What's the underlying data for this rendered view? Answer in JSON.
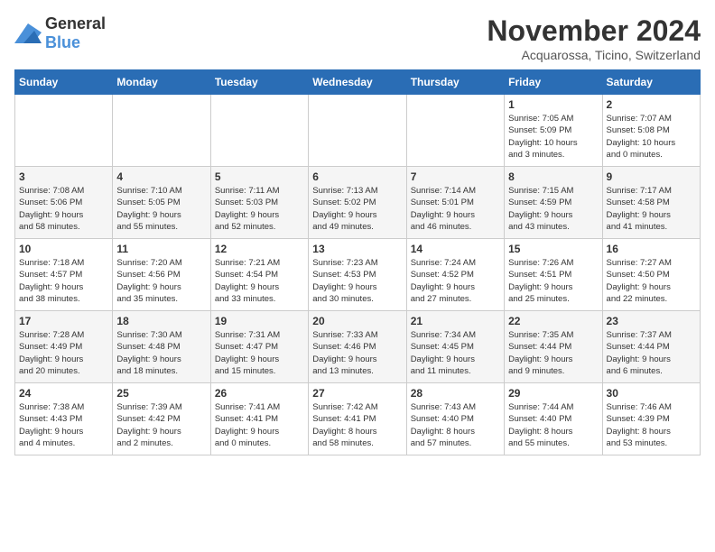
{
  "header": {
    "logo_general": "General",
    "logo_blue": "Blue",
    "title": "November 2024",
    "subtitle": "Acquarossa, Ticino, Switzerland"
  },
  "weekdays": [
    "Sunday",
    "Monday",
    "Tuesday",
    "Wednesday",
    "Thursday",
    "Friday",
    "Saturday"
  ],
  "weeks": [
    [
      {
        "day": "",
        "info": ""
      },
      {
        "day": "",
        "info": ""
      },
      {
        "day": "",
        "info": ""
      },
      {
        "day": "",
        "info": ""
      },
      {
        "day": "",
        "info": ""
      },
      {
        "day": "1",
        "info": "Sunrise: 7:05 AM\nSunset: 5:09 PM\nDaylight: 10 hours\nand 3 minutes."
      },
      {
        "day": "2",
        "info": "Sunrise: 7:07 AM\nSunset: 5:08 PM\nDaylight: 10 hours\nand 0 minutes."
      }
    ],
    [
      {
        "day": "3",
        "info": "Sunrise: 7:08 AM\nSunset: 5:06 PM\nDaylight: 9 hours\nand 58 minutes."
      },
      {
        "day": "4",
        "info": "Sunrise: 7:10 AM\nSunset: 5:05 PM\nDaylight: 9 hours\nand 55 minutes."
      },
      {
        "day": "5",
        "info": "Sunrise: 7:11 AM\nSunset: 5:03 PM\nDaylight: 9 hours\nand 52 minutes."
      },
      {
        "day": "6",
        "info": "Sunrise: 7:13 AM\nSunset: 5:02 PM\nDaylight: 9 hours\nand 49 minutes."
      },
      {
        "day": "7",
        "info": "Sunrise: 7:14 AM\nSunset: 5:01 PM\nDaylight: 9 hours\nand 46 minutes."
      },
      {
        "day": "8",
        "info": "Sunrise: 7:15 AM\nSunset: 4:59 PM\nDaylight: 9 hours\nand 43 minutes."
      },
      {
        "day": "9",
        "info": "Sunrise: 7:17 AM\nSunset: 4:58 PM\nDaylight: 9 hours\nand 41 minutes."
      }
    ],
    [
      {
        "day": "10",
        "info": "Sunrise: 7:18 AM\nSunset: 4:57 PM\nDaylight: 9 hours\nand 38 minutes."
      },
      {
        "day": "11",
        "info": "Sunrise: 7:20 AM\nSunset: 4:56 PM\nDaylight: 9 hours\nand 35 minutes."
      },
      {
        "day": "12",
        "info": "Sunrise: 7:21 AM\nSunset: 4:54 PM\nDaylight: 9 hours\nand 33 minutes."
      },
      {
        "day": "13",
        "info": "Sunrise: 7:23 AM\nSunset: 4:53 PM\nDaylight: 9 hours\nand 30 minutes."
      },
      {
        "day": "14",
        "info": "Sunrise: 7:24 AM\nSunset: 4:52 PM\nDaylight: 9 hours\nand 27 minutes."
      },
      {
        "day": "15",
        "info": "Sunrise: 7:26 AM\nSunset: 4:51 PM\nDaylight: 9 hours\nand 25 minutes."
      },
      {
        "day": "16",
        "info": "Sunrise: 7:27 AM\nSunset: 4:50 PM\nDaylight: 9 hours\nand 22 minutes."
      }
    ],
    [
      {
        "day": "17",
        "info": "Sunrise: 7:28 AM\nSunset: 4:49 PM\nDaylight: 9 hours\nand 20 minutes."
      },
      {
        "day": "18",
        "info": "Sunrise: 7:30 AM\nSunset: 4:48 PM\nDaylight: 9 hours\nand 18 minutes."
      },
      {
        "day": "19",
        "info": "Sunrise: 7:31 AM\nSunset: 4:47 PM\nDaylight: 9 hours\nand 15 minutes."
      },
      {
        "day": "20",
        "info": "Sunrise: 7:33 AM\nSunset: 4:46 PM\nDaylight: 9 hours\nand 13 minutes."
      },
      {
        "day": "21",
        "info": "Sunrise: 7:34 AM\nSunset: 4:45 PM\nDaylight: 9 hours\nand 11 minutes."
      },
      {
        "day": "22",
        "info": "Sunrise: 7:35 AM\nSunset: 4:44 PM\nDaylight: 9 hours\nand 9 minutes."
      },
      {
        "day": "23",
        "info": "Sunrise: 7:37 AM\nSunset: 4:44 PM\nDaylight: 9 hours\nand 6 minutes."
      }
    ],
    [
      {
        "day": "24",
        "info": "Sunrise: 7:38 AM\nSunset: 4:43 PM\nDaylight: 9 hours\nand 4 minutes."
      },
      {
        "day": "25",
        "info": "Sunrise: 7:39 AM\nSunset: 4:42 PM\nDaylight: 9 hours\nand 2 minutes."
      },
      {
        "day": "26",
        "info": "Sunrise: 7:41 AM\nSunset: 4:41 PM\nDaylight: 9 hours\nand 0 minutes."
      },
      {
        "day": "27",
        "info": "Sunrise: 7:42 AM\nSunset: 4:41 PM\nDaylight: 8 hours\nand 58 minutes."
      },
      {
        "day": "28",
        "info": "Sunrise: 7:43 AM\nSunset: 4:40 PM\nDaylight: 8 hours\nand 57 minutes."
      },
      {
        "day": "29",
        "info": "Sunrise: 7:44 AM\nSunset: 4:40 PM\nDaylight: 8 hours\nand 55 minutes."
      },
      {
        "day": "30",
        "info": "Sunrise: 7:46 AM\nSunset: 4:39 PM\nDaylight: 8 hours\nand 53 minutes."
      }
    ]
  ]
}
